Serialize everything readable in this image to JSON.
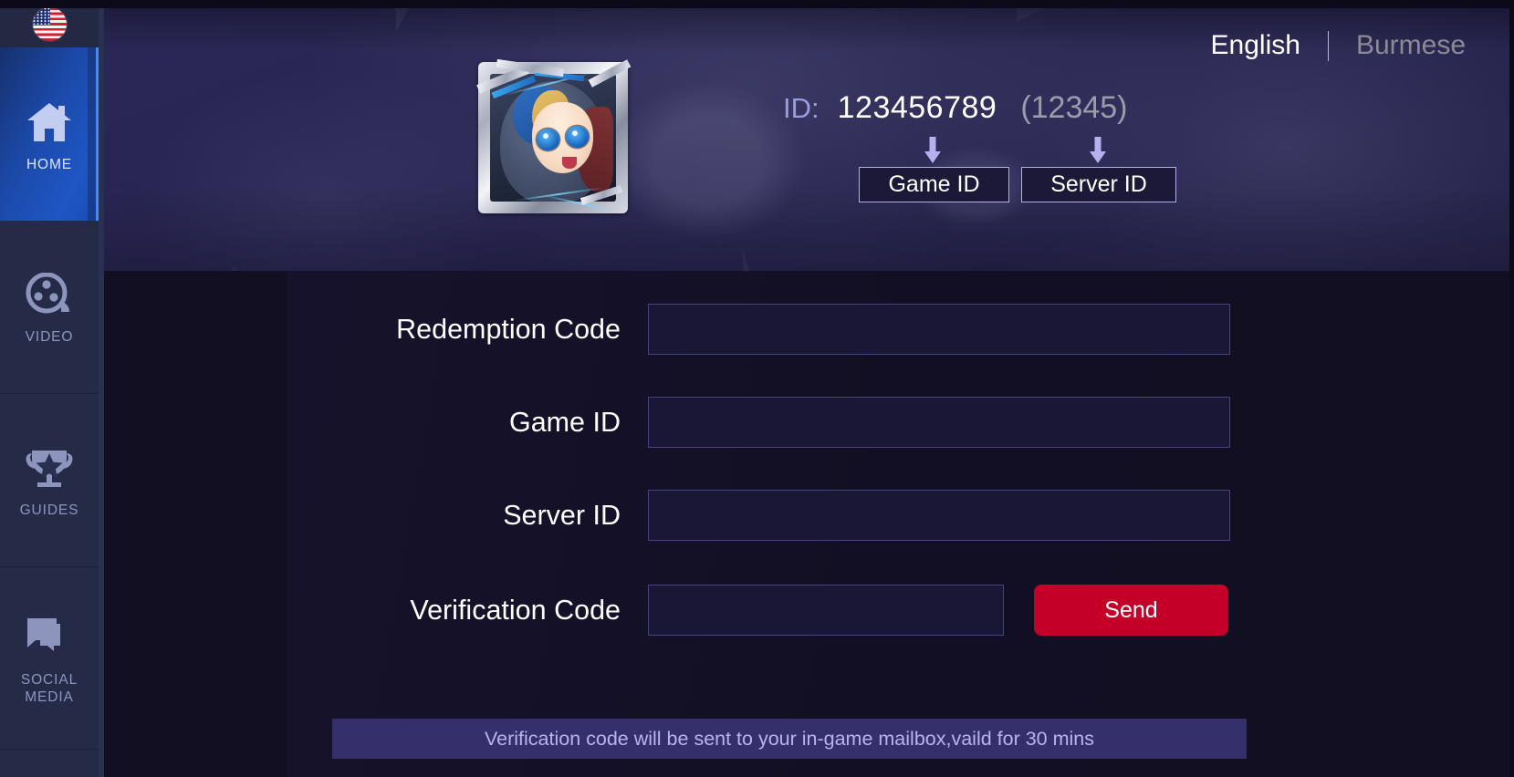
{
  "sidebar": {
    "flag_icon": "us-flag-circle-icon",
    "items": [
      {
        "id": "home",
        "label": "HOME",
        "icon": "home-icon",
        "active": true
      },
      {
        "id": "video",
        "label": "VIDEO",
        "icon": "film-reel-icon",
        "active": false
      },
      {
        "id": "guides",
        "label": "GUIDES",
        "icon": "trophy-star-icon",
        "active": false
      },
      {
        "id": "social",
        "label": "SOCIAL MEDIA",
        "icon": "chat-bubbles-icon",
        "active": false
      }
    ],
    "social_label_line1": "SOCIAL",
    "social_label_line2": "MEDIA"
  },
  "header": {
    "languages": {
      "active": "English",
      "inactive": "Burmese"
    },
    "avatar_icon": "player-avatar-framed",
    "id_label": "ID:",
    "game_id_value": "123456789",
    "server_id_value": "(12345)",
    "pointer_icon": "arrow-down-icon",
    "game_id_box": "Game ID",
    "server_id_box": "Server ID"
  },
  "form": {
    "rows": [
      {
        "label": "Redemption Code",
        "value": "",
        "placeholder": ""
      },
      {
        "label": "Game ID",
        "value": "",
        "placeholder": ""
      },
      {
        "label": "Server ID",
        "value": "",
        "placeholder": ""
      },
      {
        "label": "Verification Code",
        "value": "",
        "placeholder": ""
      }
    ],
    "send_label": "Send",
    "notice": "Verification code will be sent to your in-game mailbox,vaild for 30 mins"
  },
  "colors": {
    "sidebar_bg": "#252b46",
    "sidebar_active": "#1f56c4",
    "sidebar_accent": "#3b8cff",
    "banner_bg": "#272450",
    "page_bg": "#120f23",
    "input_bg": "#191636",
    "input_border": "#4a4280",
    "send_red": "#c40028",
    "notice_bg": "#35306c",
    "notice_text": "#b8b4ef",
    "id_label_purple": "#9b9cdf",
    "lang_inactive": "#8a8a95"
  }
}
